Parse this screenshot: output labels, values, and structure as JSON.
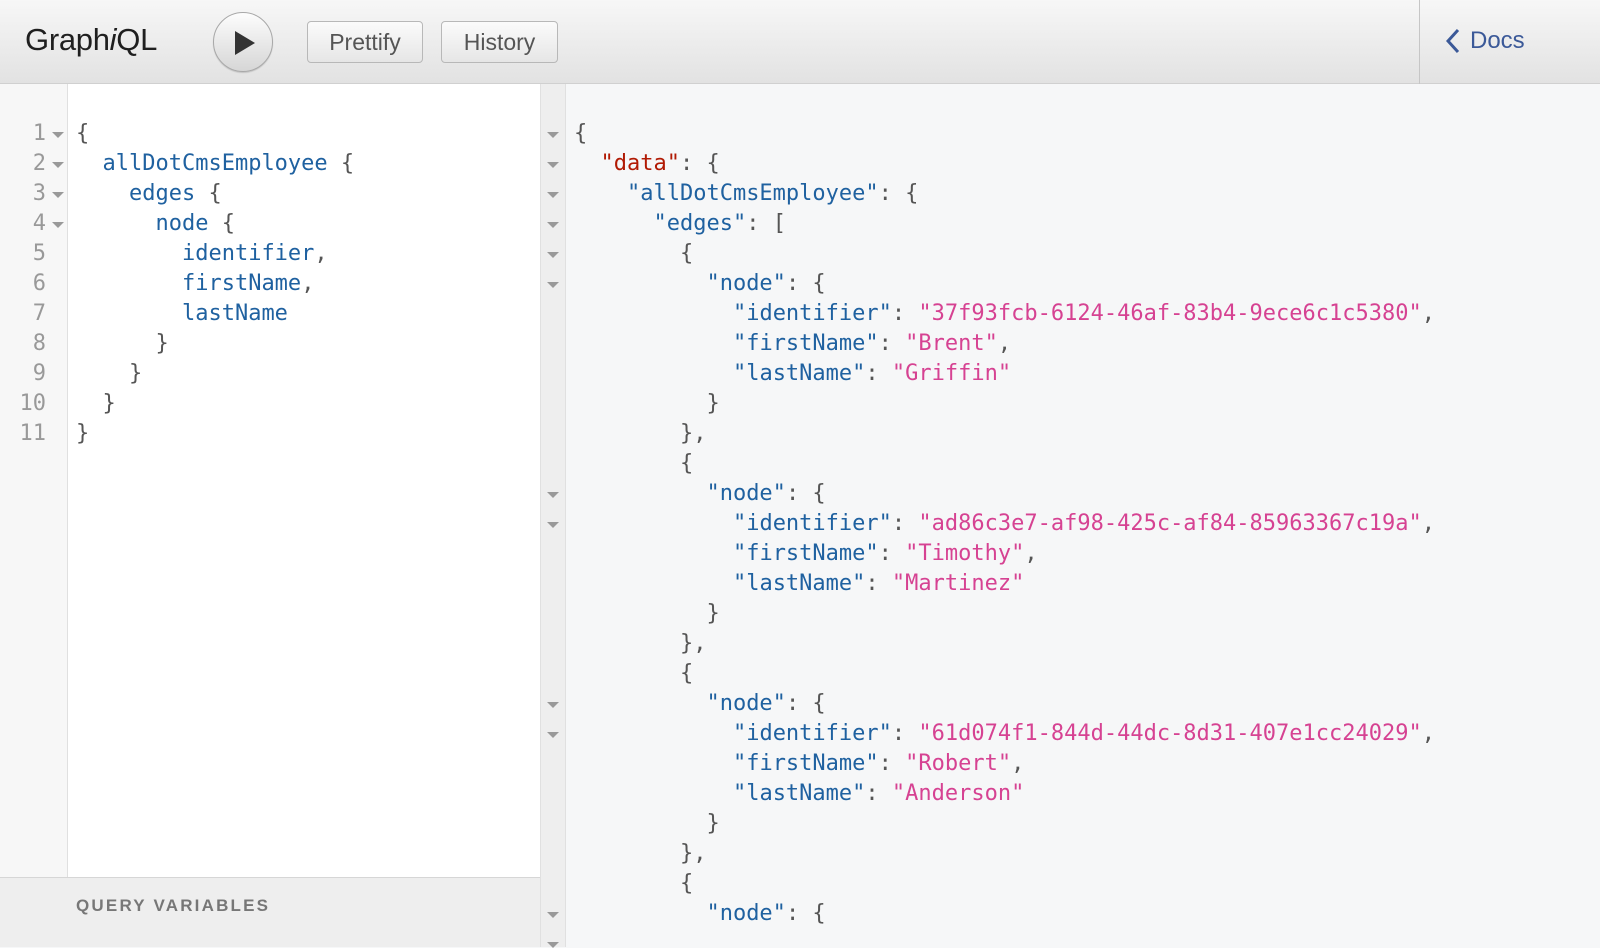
{
  "toolbar": {
    "title_prefix": "Graph",
    "title_italic": "i",
    "title_suffix": "QL",
    "run_button_icon": "play-icon",
    "prettify_label": "Prettify",
    "history_label": "History",
    "docs_label": "Docs",
    "docs_icon": "chevron-left-icon"
  },
  "editor": {
    "line_numbers": [
      "1",
      "2",
      "3",
      "4",
      "5",
      "6",
      "7",
      "8",
      "9",
      "10",
      "11"
    ],
    "foldable_lines": [
      1,
      2,
      3,
      4
    ],
    "lines": [
      [
        {
          "t": "{",
          "c": "punct"
        }
      ],
      [
        {
          "t": "  "
        },
        {
          "t": "allDotCmsEmployee",
          "c": "def"
        },
        {
          "t": " {",
          "c": "punct"
        }
      ],
      [
        {
          "t": "    "
        },
        {
          "t": "edges",
          "c": "def"
        },
        {
          "t": " {",
          "c": "punct"
        }
      ],
      [
        {
          "t": "      "
        },
        {
          "t": "node",
          "c": "def"
        },
        {
          "t": " {",
          "c": "punct"
        }
      ],
      [
        {
          "t": "        "
        },
        {
          "t": "identifier",
          "c": "def"
        },
        {
          "t": ",",
          "c": "punct"
        }
      ],
      [
        {
          "t": "        "
        },
        {
          "t": "firstName",
          "c": "def"
        },
        {
          "t": ",",
          "c": "punct"
        }
      ],
      [
        {
          "t": "        "
        },
        {
          "t": "lastName",
          "c": "def"
        }
      ],
      [
        {
          "t": "      "
        },
        {
          "t": "}",
          "c": "punct"
        }
      ],
      [
        {
          "t": "    "
        },
        {
          "t": "}",
          "c": "punct"
        }
      ],
      [
        {
          "t": "  "
        },
        {
          "t": "}",
          "c": "punct"
        }
      ],
      [
        {
          "t": "}",
          "c": "punct"
        }
      ]
    ],
    "query_variables_label": "QUERY VARIABLES"
  },
  "results": {
    "fold_markers_on_lines": [
      1,
      2,
      3,
      4,
      5,
      6,
      13,
      14,
      20,
      21,
      27,
      28
    ],
    "lines": [
      [
        {
          "t": "{",
          "c": "punct"
        }
      ],
      [
        {
          "t": "  "
        },
        {
          "t": "\"data\"",
          "c": "datakey"
        },
        {
          "t": ": {",
          "c": "punct"
        }
      ],
      [
        {
          "t": "    "
        },
        {
          "t": "\"allDotCmsEmployee\"",
          "c": "prop"
        },
        {
          "t": ": {",
          "c": "punct"
        }
      ],
      [
        {
          "t": "      "
        },
        {
          "t": "\"edges\"",
          "c": "prop"
        },
        {
          "t": ": [",
          "c": "punct"
        }
      ],
      [
        {
          "t": "        "
        },
        {
          "t": "{",
          "c": "punct"
        }
      ],
      [
        {
          "t": "          "
        },
        {
          "t": "\"node\"",
          "c": "prop"
        },
        {
          "t": ": {",
          "c": "punct"
        }
      ],
      [
        {
          "t": "            "
        },
        {
          "t": "\"identifier\"",
          "c": "prop"
        },
        {
          "t": ": ",
          "c": "punct"
        },
        {
          "t": "\"37f93fcb-6124-46af-83b4-9ece6c1c5380\"",
          "c": "str"
        },
        {
          "t": ",",
          "c": "punct"
        }
      ],
      [
        {
          "t": "            "
        },
        {
          "t": "\"firstName\"",
          "c": "prop"
        },
        {
          "t": ": ",
          "c": "punct"
        },
        {
          "t": "\"Brent\"",
          "c": "str"
        },
        {
          "t": ",",
          "c": "punct"
        }
      ],
      [
        {
          "t": "            "
        },
        {
          "t": "\"lastName\"",
          "c": "prop"
        },
        {
          "t": ": ",
          "c": "punct"
        },
        {
          "t": "\"Griffin\"",
          "c": "str"
        }
      ],
      [
        {
          "t": "          "
        },
        {
          "t": "}",
          "c": "punct"
        }
      ],
      [
        {
          "t": "        "
        },
        {
          "t": "},",
          "c": "punct"
        }
      ],
      [
        {
          "t": "        "
        },
        {
          "t": "{",
          "c": "punct"
        }
      ],
      [
        {
          "t": "          "
        },
        {
          "t": "\"node\"",
          "c": "prop"
        },
        {
          "t": ": {",
          "c": "punct"
        }
      ],
      [
        {
          "t": "            "
        },
        {
          "t": "\"identifier\"",
          "c": "prop"
        },
        {
          "t": ": ",
          "c": "punct"
        },
        {
          "t": "\"ad86c3e7-af98-425c-af84-85963367c19a\"",
          "c": "str"
        },
        {
          "t": ",",
          "c": "punct"
        }
      ],
      [
        {
          "t": "            "
        },
        {
          "t": "\"firstName\"",
          "c": "prop"
        },
        {
          "t": ": ",
          "c": "punct"
        },
        {
          "t": "\"Timothy\"",
          "c": "str"
        },
        {
          "t": ",",
          "c": "punct"
        }
      ],
      [
        {
          "t": "            "
        },
        {
          "t": "\"lastName\"",
          "c": "prop"
        },
        {
          "t": ": ",
          "c": "punct"
        },
        {
          "t": "\"Martinez\"",
          "c": "str"
        }
      ],
      [
        {
          "t": "          "
        },
        {
          "t": "}",
          "c": "punct"
        }
      ],
      [
        {
          "t": "        "
        },
        {
          "t": "},",
          "c": "punct"
        }
      ],
      [
        {
          "t": "        "
        },
        {
          "t": "{",
          "c": "punct"
        }
      ],
      [
        {
          "t": "          "
        },
        {
          "t": "\"node\"",
          "c": "prop"
        },
        {
          "t": ": {",
          "c": "punct"
        }
      ],
      [
        {
          "t": "            "
        },
        {
          "t": "\"identifier\"",
          "c": "prop"
        },
        {
          "t": ": ",
          "c": "punct"
        },
        {
          "t": "\"61d074f1-844d-44dc-8d31-407e1cc24029\"",
          "c": "str"
        },
        {
          "t": ",",
          "c": "punct"
        }
      ],
      [
        {
          "t": "            "
        },
        {
          "t": "\"firstName\"",
          "c": "prop"
        },
        {
          "t": ": ",
          "c": "punct"
        },
        {
          "t": "\"Robert\"",
          "c": "str"
        },
        {
          "t": ",",
          "c": "punct"
        }
      ],
      [
        {
          "t": "            "
        },
        {
          "t": "\"lastName\"",
          "c": "prop"
        },
        {
          "t": ": ",
          "c": "punct"
        },
        {
          "t": "\"Anderson\"",
          "c": "str"
        }
      ],
      [
        {
          "t": "          "
        },
        {
          "t": "}",
          "c": "punct"
        }
      ],
      [
        {
          "t": "        "
        },
        {
          "t": "},",
          "c": "punct"
        }
      ],
      [
        {
          "t": "        "
        },
        {
          "t": "{",
          "c": "punct"
        }
      ],
      [
        {
          "t": "          "
        },
        {
          "t": "\"node\"",
          "c": "prop"
        },
        {
          "t": ": {",
          "c": "punct"
        }
      ]
    ]
  },
  "colors": {
    "field": "#1f61a0",
    "string": "#d64292",
    "data_key": "#b11a04",
    "punctuation": "#555555",
    "docs_link": "#3b5998"
  }
}
